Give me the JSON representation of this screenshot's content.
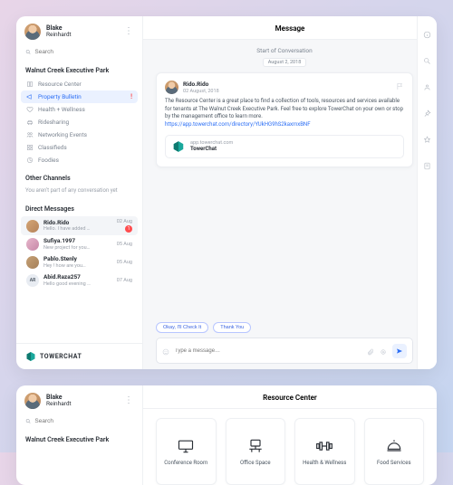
{
  "user": {
    "first": "Blake",
    "last": "Reinhardt"
  },
  "search": {
    "placeholder": "Search"
  },
  "workspace": "Walnut Creek Executive Park",
  "channels": [
    {
      "icon": "book",
      "label": "Resource Center"
    },
    {
      "icon": "horn",
      "label": "Property Bulletin",
      "active": true,
      "alert": "!"
    },
    {
      "icon": "heart",
      "label": "Health + Wellness"
    },
    {
      "icon": "car",
      "label": "Ridesharing"
    },
    {
      "icon": "people",
      "label": "Networking Events"
    },
    {
      "icon": "grid",
      "label": "Classifieds"
    },
    {
      "icon": "food",
      "label": "Foodies"
    }
  ],
  "other_title": "Other Channels",
  "other_empty": "You aren't part of any conversation yet",
  "dm_title": "Direct Messages",
  "dms": [
    {
      "name": "Rido.Rido",
      "preview": "Hello. I have added …",
      "date": "02 Aug",
      "badge": "1",
      "selected": true,
      "av": "photo1"
    },
    {
      "name": "Sufiya.1997",
      "preview": "New project for you…",
      "date": "05 Aug",
      "av": "photo2"
    },
    {
      "name": "Pablo.Stenly",
      "preview": "Hey ! how are you…",
      "date": "05 Aug",
      "av": "photo3"
    },
    {
      "name": "Abid.Raza257",
      "preview": "Hello good evening …",
      "date": "07 Aug",
      "av": "AR",
      "initials": true
    }
  ],
  "brand": "TOWERCHAT",
  "header": {
    "title": "Message"
  },
  "conversation": {
    "start_label": "Start of Conversation",
    "date_chip": "August 2, 2018",
    "message": {
      "author": "Rido.Rido",
      "date": "02 August, 2018",
      "body": "The Resource Center is a great place to find a collection of tools, resources and services available for tenants at The Walnut Creek Executive Park. Feel free to explore TowerChat on your own or stop by the management office to learn more.",
      "link": "https://app.towerchat.com/directory/YUkHG9hS2kaxmxBNF",
      "link_host": "app.towerchat.com",
      "link_title": "TowerChat"
    },
    "suggestions": [
      "Okay, I'll Check It",
      "Thank You"
    ],
    "composer_placeholder": "Type a message…"
  },
  "screen2": {
    "title": "Resource Center",
    "tiles": [
      "Conference Room",
      "Office Space",
      "Health & Wellness",
      "Food Services"
    ]
  }
}
